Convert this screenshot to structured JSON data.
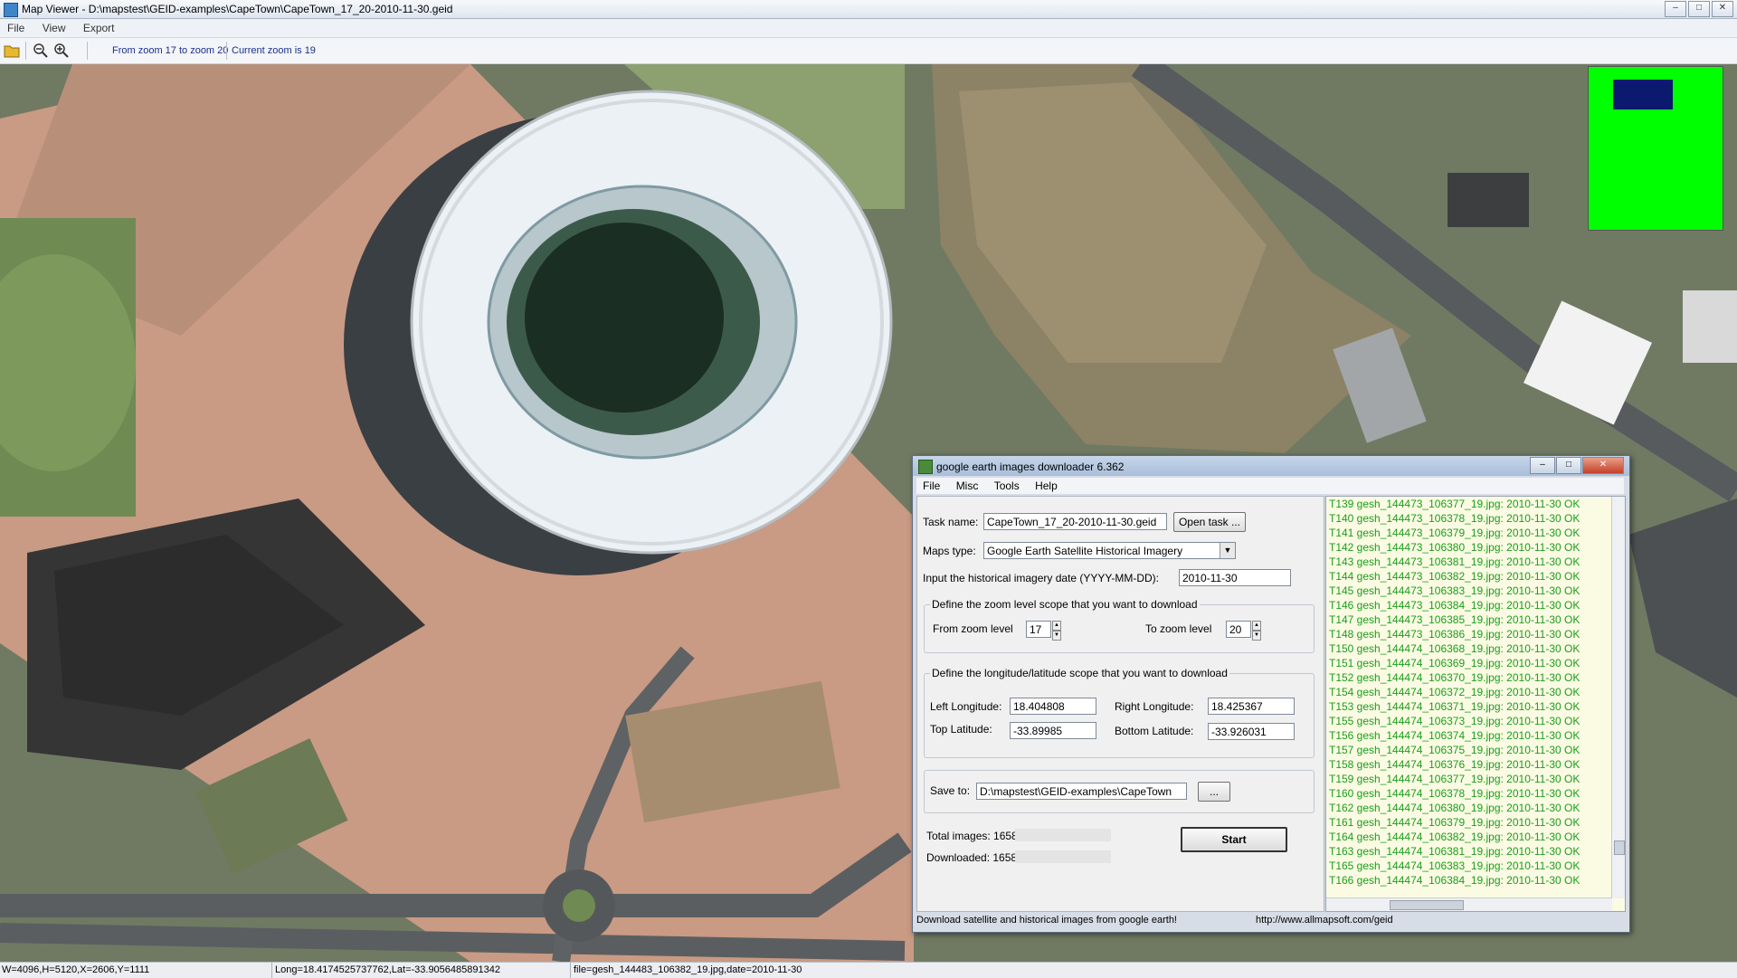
{
  "window": {
    "title": "Map Viewer - D:\\mapstest\\GEID-examples\\CapeTown\\CapeTown_17_20-2010-11-30.geid"
  },
  "menu": [
    "File",
    "View",
    "Export"
  ],
  "toolbar": {
    "zoom_range": "From zoom 17 to zoom 20",
    "current_zoom": "Current zoom is 19"
  },
  "status": {
    "dims": "W=4096,H=5120,X=2606,Y=1111",
    "coords": "Long=18.4174525737762,Lat=-33.9056485891342",
    "file": "file=gesh_144483_106382_19.jpg,date=2010-11-30"
  },
  "minimap": {
    "bg_color": "#00ff00",
    "view_color": "#0b1a6e"
  },
  "dialog": {
    "title": "google earth images downloader 6.362",
    "menu": [
      "File",
      "Misc",
      "Tools",
      "Help"
    ],
    "task_label": "Task name:",
    "task_value": "CapeTown_17_20-2010-11-30.geid",
    "open_task": "Open task ...",
    "maps_label": "Maps type:",
    "maps_value": "Google Earth Satellite Historical Imagery",
    "date_label": "Input the  historical imagery date (YYYY-MM-DD):",
    "date_value": "2010-11-30",
    "zoom_group": "Define the zoom level scope that you want to download",
    "from_label": "From zoom level",
    "from_value": "17",
    "to_label": "To zoom level",
    "to_value": "20",
    "lonlat_group": "Define the longitude/latitude scope that you want to download",
    "left_lon_label": "Left Longitude:",
    "left_lon": "18.404808",
    "right_lon_label": "Right Longitude:",
    "right_lon": "18.425367",
    "top_lat_label": "Top Latitude:",
    "top_lat": "-33.89985",
    "bottom_lat_label": "Bottom Latitude:",
    "bottom_lat": "-33.926031",
    "save_label": "Save to:",
    "save_value": "D:\\mapstest\\GEID-examples\\CapeTown",
    "browse": "...",
    "total": "Total images: 1658",
    "downloaded": "Downloaded: 1658",
    "start": "Start",
    "status_left": "Download satellite and historical  images from google earth!",
    "status_right": "http://www.allmapsoft.com/geid",
    "log": [
      "T139 gesh_144473_106377_19.jpg: 2010-11-30 OK",
      "T140 gesh_144473_106378_19.jpg: 2010-11-30 OK",
      "T141 gesh_144473_106379_19.jpg: 2010-11-30 OK",
      "T142 gesh_144473_106380_19.jpg: 2010-11-30 OK",
      "T143 gesh_144473_106381_19.jpg: 2010-11-30 OK",
      "T144 gesh_144473_106382_19.jpg: 2010-11-30 OK",
      "T145 gesh_144473_106383_19.jpg: 2010-11-30 OK",
      "T146 gesh_144473_106384_19.jpg: 2010-11-30 OK",
      "T147 gesh_144473_106385_19.jpg: 2010-11-30 OK",
      "T148 gesh_144473_106386_19.jpg: 2010-11-30 OK",
      "T150 gesh_144474_106368_19.jpg: 2010-11-30 OK",
      "T151 gesh_144474_106369_19.jpg: 2010-11-30 OK",
      "T152 gesh_144474_106370_19.jpg: 2010-11-30 OK",
      "T154 gesh_144474_106372_19.jpg: 2010-11-30 OK",
      "T153 gesh_144474_106371_19.jpg: 2010-11-30 OK",
      "T155 gesh_144474_106373_19.jpg: 2010-11-30 OK",
      "T156 gesh_144474_106374_19.jpg: 2010-11-30 OK",
      "T157 gesh_144474_106375_19.jpg: 2010-11-30 OK",
      "T158 gesh_144474_106376_19.jpg: 2010-11-30 OK",
      "T159 gesh_144474_106377_19.jpg: 2010-11-30 OK",
      "T160 gesh_144474_106378_19.jpg: 2010-11-30 OK",
      "T162 gesh_144474_106380_19.jpg: 2010-11-30 OK",
      "T161 gesh_144474_106379_19.jpg: 2010-11-30 OK",
      "T164 gesh_144474_106382_19.jpg: 2010-11-30 OK",
      "T163 gesh_144474_106381_19.jpg: 2010-11-30 OK",
      "T165 gesh_144474_106383_19.jpg: 2010-11-30 OK",
      "T166 gesh_144474_106384_19.jpg: 2010-11-30 OK"
    ]
  }
}
